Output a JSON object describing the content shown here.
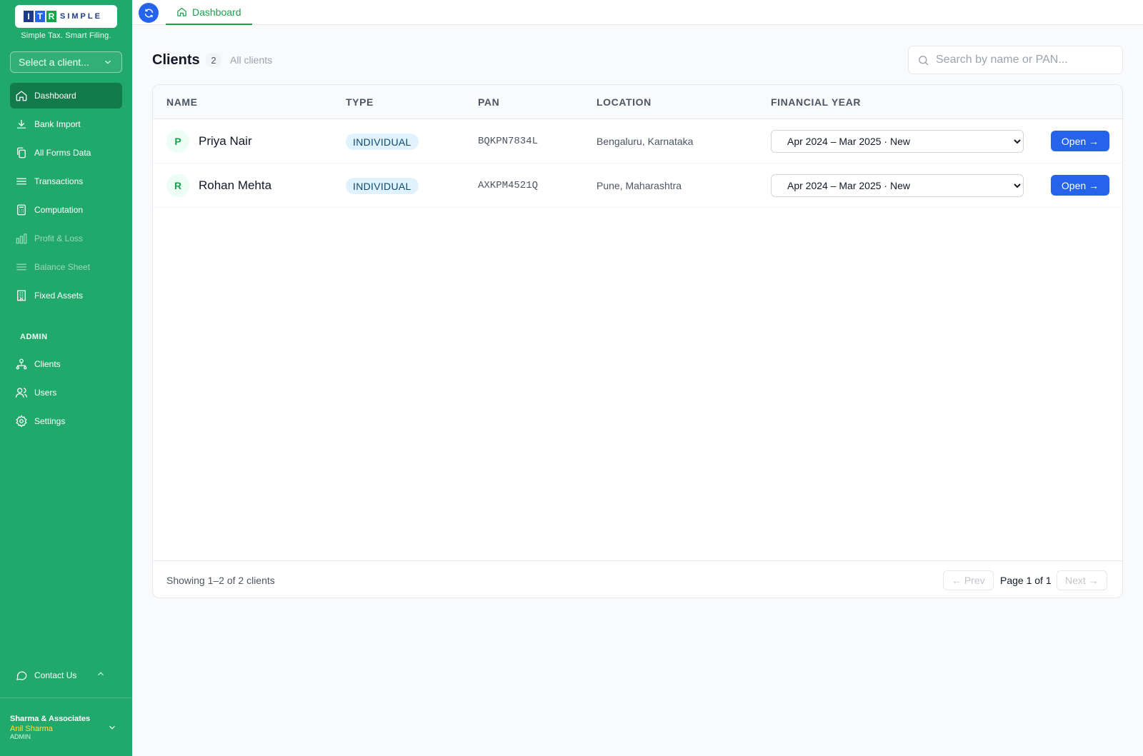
{
  "brand": {
    "logo_letters": [
      "I",
      "T",
      "R"
    ],
    "logo_rest": "SIMPLE",
    "tagline": "Simple Tax. Smart Filing.",
    "colors": {
      "sidebar": "#21a96b",
      "active": "#127a4b",
      "primary": "#2563eb"
    }
  },
  "client_select": {
    "label": "Select a client..."
  },
  "nav": [
    {
      "label": "Dashboard",
      "icon": "home-icon",
      "active": true,
      "disabled": false
    },
    {
      "label": "Bank Import",
      "icon": "download-icon",
      "active": false,
      "disabled": false
    },
    {
      "label": "All Forms Data",
      "icon": "copy-icon",
      "active": false,
      "disabled": false
    },
    {
      "label": "Transactions",
      "icon": "list-icon",
      "active": false,
      "disabled": false
    },
    {
      "label": "Computation",
      "icon": "calculator-icon",
      "active": false,
      "disabled": false
    },
    {
      "label": "Profit & Loss",
      "icon": "bar-chart-icon",
      "active": false,
      "disabled": true
    },
    {
      "label": "Balance Sheet",
      "icon": "list-icon",
      "active": false,
      "disabled": true
    },
    {
      "label": "Fixed Assets",
      "icon": "building-icon",
      "active": false,
      "disabled": false
    }
  ],
  "admin": {
    "label": "ADMIN",
    "items": [
      {
        "label": "Clients",
        "icon": "network-icon"
      },
      {
        "label": "Users",
        "icon": "users-icon"
      },
      {
        "label": "Settings",
        "icon": "gear-icon"
      }
    ]
  },
  "contact": {
    "label": "Contact Us"
  },
  "account": {
    "org": "Sharma & Associates",
    "user": "Anil Sharma",
    "role": "ADMIN"
  },
  "tabs": [
    {
      "label": "Dashboard",
      "icon": "home-icon"
    }
  ],
  "header": {
    "title": "Clients",
    "count": "2",
    "subtitle": "All clients"
  },
  "search": {
    "placeholder": "Search by name or PAN...",
    "value": ""
  },
  "table": {
    "columns": [
      "NAME",
      "TYPE",
      "PAN",
      "LOCATION",
      "FINANCIAL YEAR"
    ],
    "rows": [
      {
        "initial": "P",
        "name": "Priya Nair",
        "type": "INDIVIDUAL",
        "pan": "BQKPN7834L",
        "location": "Bengaluru, Karnataka",
        "fy": "Apr 2024 – Mar 2025 · New",
        "action": "Open →"
      },
      {
        "initial": "R",
        "name": "Rohan Mehta",
        "type": "INDIVIDUAL",
        "pan": "AXKPM4521Q",
        "location": "Pune, Maharashtra",
        "fy": "Apr 2024 – Mar 2025 · New",
        "action": "Open →"
      }
    ]
  },
  "pagination": {
    "showing": "Showing 1–2 of 2 clients",
    "prev": "← Prev",
    "page": "Page 1 of 1",
    "next": "Next →"
  }
}
